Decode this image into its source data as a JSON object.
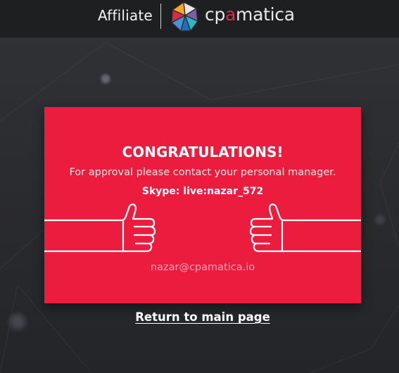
{
  "header": {
    "affiliate_label": "Affiliate",
    "logo": {
      "text_part1": "cp",
      "text_part2": "a",
      "text_part3": "matica",
      "accent_color": "#d32d4a"
    }
  },
  "card": {
    "background_color": "#ec1c3e",
    "title": "CONGRATULATIONS!",
    "subtitle": "For approval please contact your personal manager.",
    "skype": "Skype: live:nazar_572",
    "email": "nazar@cpamatica.io",
    "icons": [
      "thumbs-up-icon",
      "thumbs-up-icon"
    ]
  },
  "footer": {
    "return_link": "Return to main page"
  }
}
